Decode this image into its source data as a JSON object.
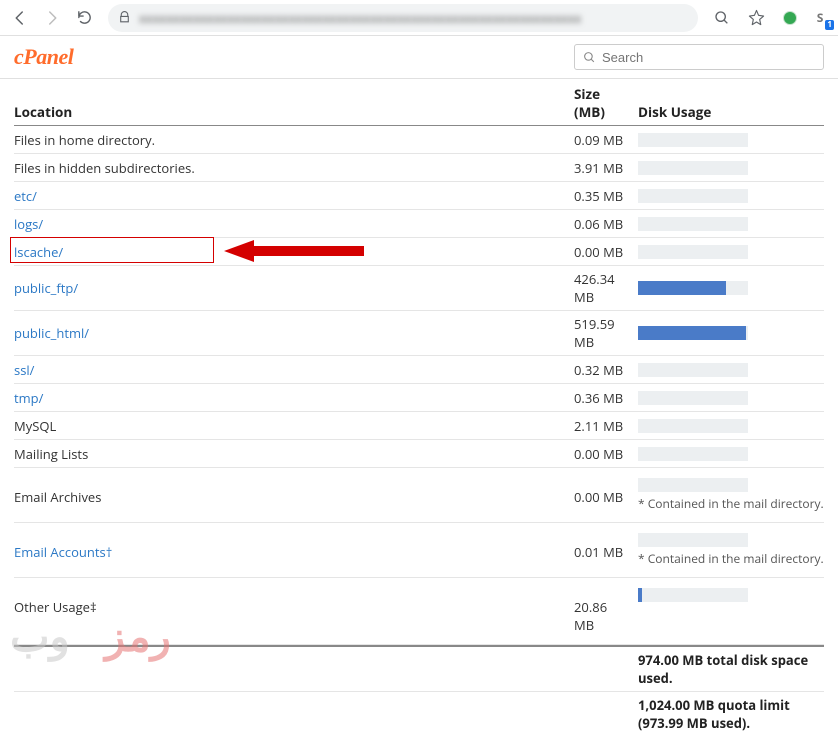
{
  "browser": {
    "url_blurred": "xxxxxxxxxxxxxxxxxxxxxxxxxxxxxxxxxxxxxxxxxxxxxxxxxxxxxxxxxxxxxxxxx",
    "ext_label": "S",
    "ext_badge": "1"
  },
  "header": {
    "logo": "cPanel",
    "search_placeholder": "Search"
  },
  "columns": {
    "location": "Location",
    "size": "Size (MB)",
    "usage": "Disk Usage"
  },
  "rows": [
    {
      "label": "Files in home directory.",
      "link": false,
      "size": "0.09 MB",
      "bar": 0,
      "highlight": false
    },
    {
      "label": "Files in hidden subdirectories.",
      "link": false,
      "size": "3.91 MB",
      "bar": 0,
      "highlight": false
    },
    {
      "label": "etc/",
      "link": true,
      "size": "0.35 MB",
      "bar": 0,
      "highlight": false
    },
    {
      "label": "logs/",
      "link": true,
      "size": "0.06 MB",
      "bar": 0,
      "highlight": false
    },
    {
      "label": "lscache/",
      "link": true,
      "size": "0.00 MB",
      "bar": 0,
      "highlight": true
    },
    {
      "label": "public_ftp/",
      "link": true,
      "size": "426.34 MB",
      "bar": 80,
      "highlight": false
    },
    {
      "label": "public_html/",
      "link": true,
      "size": "519.59 MB",
      "bar": 98,
      "highlight": false
    },
    {
      "label": "ssl/",
      "link": true,
      "size": "0.32 MB",
      "bar": 0,
      "highlight": false
    },
    {
      "label": "tmp/",
      "link": true,
      "size": "0.36 MB",
      "bar": 0,
      "highlight": false
    },
    {
      "label": "MySQL",
      "link": false,
      "size": "2.11 MB",
      "bar": 0,
      "highlight": false
    },
    {
      "label": "Mailing Lists",
      "link": false,
      "size": "0.00 MB",
      "bar": 0,
      "highlight": false
    }
  ],
  "tall_rows": [
    {
      "label": "Email Archives",
      "link": false,
      "size": "0.00 MB",
      "bar": 0,
      "note": "* Contained in the mail directory."
    },
    {
      "label": "Email Accounts†",
      "link": true,
      "size": "0.01 MB",
      "bar": 0,
      "note": "* Contained in the mail directory."
    },
    {
      "label": "Other Usage‡",
      "link": false,
      "size": "20.86 MB",
      "bar": 4,
      "note": ""
    }
  ],
  "summary": {
    "line1": "974.00 MB total disk space used.",
    "line2": "1,024.00 MB quota limit (973.99 MB used)."
  },
  "watermark_text": "وب رمز"
}
